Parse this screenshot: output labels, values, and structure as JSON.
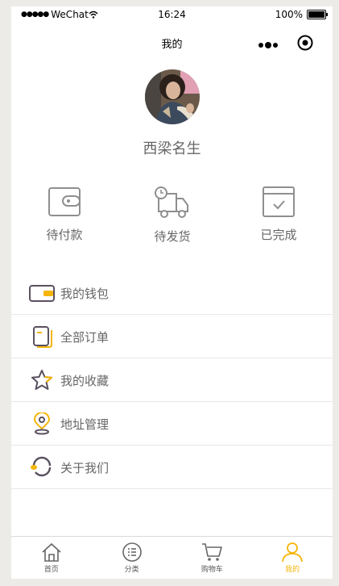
{
  "status_bar": {
    "carrier": "WeChat",
    "signal_dots": "●●●●●",
    "time": "16:24",
    "battery": "100%"
  },
  "nav": {
    "title": "我的",
    "more_icon": "more-dots-icon",
    "close_icon": "target-close-icon"
  },
  "profile": {
    "username": "西梁名生"
  },
  "orders": [
    {
      "label": "待付款",
      "icon": "wallet-icon"
    },
    {
      "label": "待发货",
      "icon": "truck-icon"
    },
    {
      "label": "已完成",
      "icon": "calendar-check-icon"
    }
  ],
  "menu": [
    {
      "label": "我的钱包",
      "icon": "wallet-icon"
    },
    {
      "label": "全部订单",
      "icon": "order-document-icon"
    },
    {
      "label": "我的收藏",
      "icon": "star-icon"
    },
    {
      "label": "地址管理",
      "icon": "location-pin-icon"
    },
    {
      "label": "关于我们",
      "icon": "about-ring-icon"
    }
  ],
  "tabs": [
    {
      "label": "首页",
      "icon": "home-icon"
    },
    {
      "label": "分类",
      "icon": "category-list-icon"
    },
    {
      "label": "购物车",
      "icon": "cart-icon"
    },
    {
      "label": "我的",
      "icon": "user-icon",
      "active": true
    }
  ],
  "colors": {
    "accent": "#f5b50a",
    "icon_dark": "#5a5160",
    "text_gray": "#666666"
  }
}
